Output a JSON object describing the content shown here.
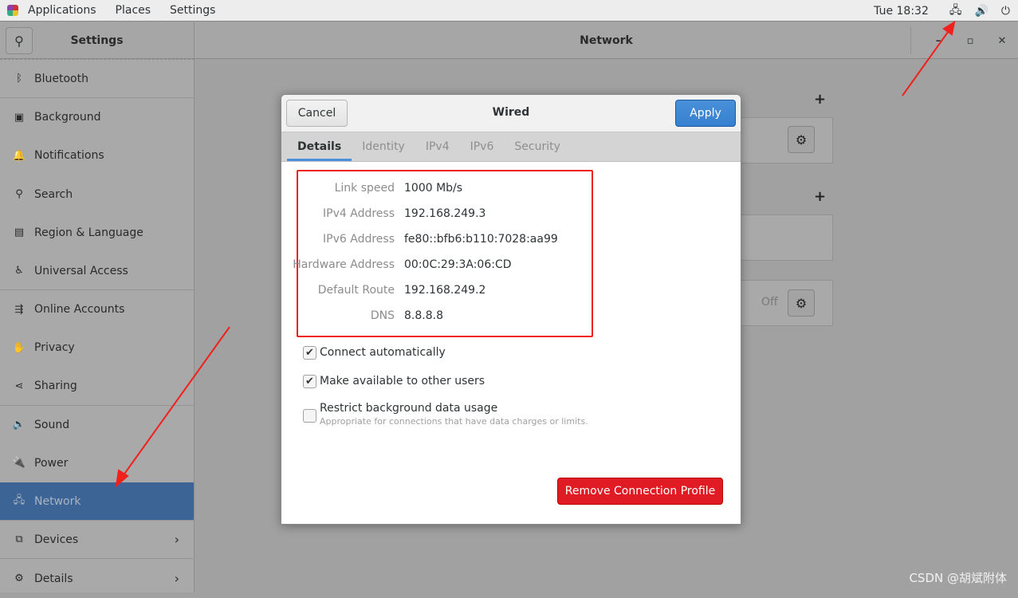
{
  "topbar": {
    "menus": [
      "Applications",
      "Places",
      "Settings"
    ],
    "clock": "Tue 18:32",
    "icons": [
      "network-wired-icon",
      "volume-icon",
      "power-icon"
    ]
  },
  "settings": {
    "title": "Settings",
    "page_title": "Network"
  },
  "sidebar": {
    "items": [
      {
        "label": "Bluetooth",
        "icon": "ᛒ"
      },
      {
        "label": "Background",
        "icon": "▣"
      },
      {
        "label": "Notifications",
        "icon": "🔔"
      },
      {
        "label": "Search",
        "icon": "⚲"
      },
      {
        "label": "Region & Language",
        "icon": "▤"
      },
      {
        "label": "Universal Access",
        "icon": "♿"
      },
      {
        "label": "Online Accounts",
        "icon": "⇶"
      },
      {
        "label": "Privacy",
        "icon": "✋"
      },
      {
        "label": "Sharing",
        "icon": "⋖"
      },
      {
        "label": "Sound",
        "icon": "🔈"
      },
      {
        "label": "Power",
        "icon": "🔌"
      },
      {
        "label": "Network",
        "icon": "🖧"
      },
      {
        "label": "Devices",
        "icon": "⧉"
      },
      {
        "label": "Details",
        "icon": "⚙"
      }
    ],
    "selected": "Network"
  },
  "background_panel": {
    "off_label": "Off"
  },
  "dialog": {
    "title": "Wired",
    "cancel": "Cancel",
    "apply": "Apply",
    "tabs": [
      "Details",
      "Identity",
      "IPv4",
      "IPv6",
      "Security"
    ],
    "active_tab": "Details",
    "details": [
      {
        "k": "Link speed",
        "v": "1000 Mb/s"
      },
      {
        "k": "IPv4 Address",
        "v": "192.168.249.3"
      },
      {
        "k": "IPv6 Address",
        "v": "fe80::bfb6:b110:7028:aa99"
      },
      {
        "k": "Hardware Address",
        "v": "00:0C:29:3A:06:CD"
      },
      {
        "k": "Default Route",
        "v": "192.168.249.2"
      },
      {
        "k": "DNS",
        "v": "8.8.8.8"
      }
    ],
    "options": [
      {
        "label": "Connect automatically",
        "checked": true
      },
      {
        "label": "Make available to other users",
        "checked": true
      },
      {
        "label": "Restrict background data usage",
        "checked": false,
        "sub": "Appropriate for connections that have data charges or limits."
      }
    ],
    "remove": "Remove Connection Profile"
  },
  "colors": {
    "accent": "#4a90d9",
    "destructive": "#e01b24",
    "annotation": "#f0201d"
  },
  "watermark": "CSDN @胡斌附体"
}
